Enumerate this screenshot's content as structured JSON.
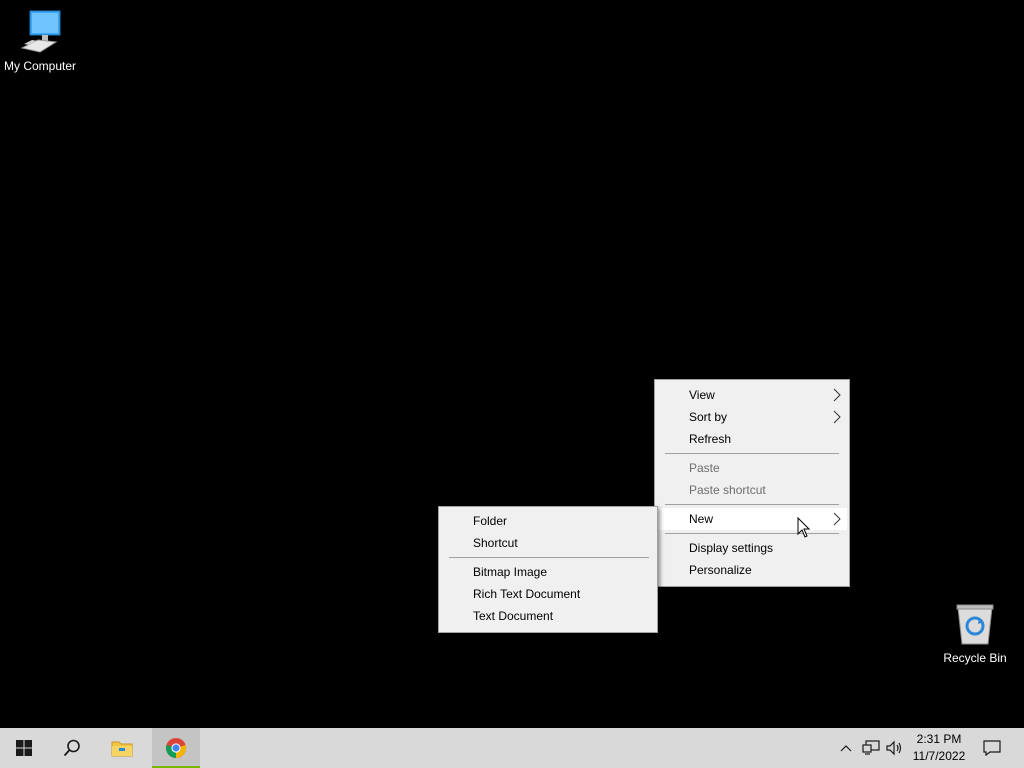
{
  "desktop": {
    "icons": [
      {
        "label": "My Computer",
        "icon": "computer-icon"
      },
      {
        "label": "Recycle Bin",
        "icon": "recycle-bin-icon"
      }
    ]
  },
  "context_menu": {
    "items": [
      {
        "label": "View",
        "has_submenu": true,
        "enabled": true
      },
      {
        "label": "Sort by",
        "has_submenu": true,
        "enabled": true
      },
      {
        "label": "Refresh",
        "has_submenu": false,
        "enabled": true
      },
      {
        "label": "Paste",
        "has_submenu": false,
        "enabled": false
      },
      {
        "label": "Paste shortcut",
        "has_submenu": false,
        "enabled": false
      },
      {
        "label": "New",
        "has_submenu": true,
        "enabled": true,
        "highlighted": true
      },
      {
        "label": "Display settings",
        "has_submenu": false,
        "enabled": true
      },
      {
        "label": "Personalize",
        "has_submenu": false,
        "enabled": true
      }
    ]
  },
  "new_submenu": {
    "items": [
      {
        "label": "Folder"
      },
      {
        "label": "Shortcut"
      },
      {
        "label": "Bitmap Image"
      },
      {
        "label": "Rich Text Document"
      },
      {
        "label": "Text Document"
      }
    ]
  },
  "taskbar": {
    "buttons": [
      "start-icon",
      "search-icon",
      "file-explorer-icon",
      "chrome-icon"
    ],
    "tray_icons": [
      "chevron-up-icon",
      "network-icon",
      "volume-icon"
    ],
    "clock": {
      "time": "2:31 PM",
      "date": "11/7/2022"
    },
    "notification_icon": "action-center-icon"
  },
  "colors": {
    "desktop_background": "#000000",
    "menu_background": "#f0f0f0",
    "taskbar_background": "#d9d9d9",
    "active_app_indicator": "#76b900"
  }
}
